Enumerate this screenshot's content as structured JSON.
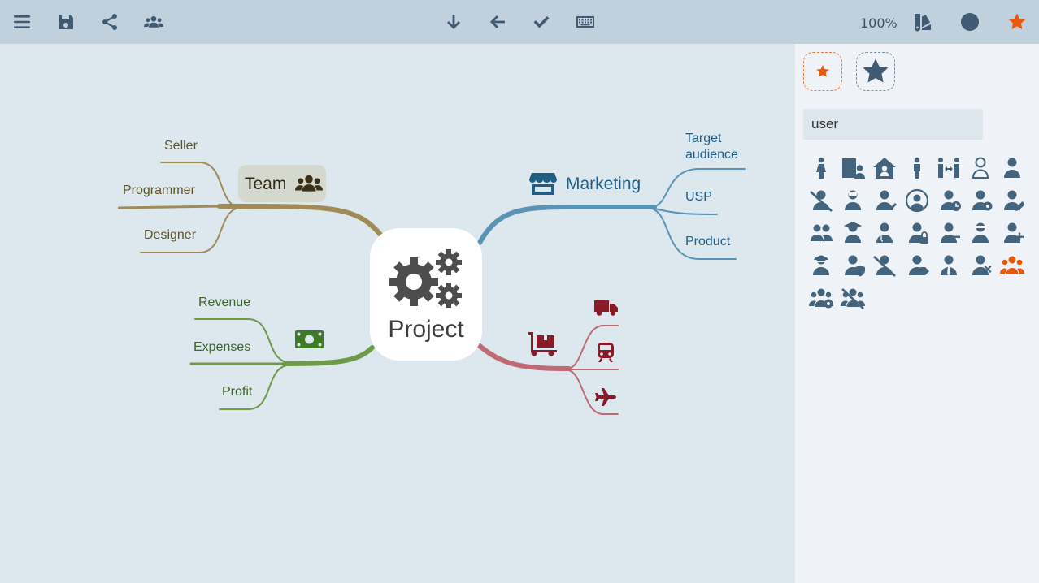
{
  "toolbar": {
    "zoom": "100%",
    "left_buttons": [
      "menu-icon",
      "save-icon",
      "share-icon",
      "users-icon"
    ],
    "center_buttons": [
      "arrow-down-icon",
      "arrow-left-icon",
      "check-icon",
      "keyboard-icon"
    ],
    "right_buttons": [
      "style-swatches-icon",
      "circle-icon",
      "star-icon"
    ]
  },
  "mindmap": {
    "center": {
      "title": "Project",
      "icon": "gears-icon"
    },
    "branches": {
      "team": {
        "label": "Team",
        "icon": "users-icon",
        "color": "#a08b55",
        "children": [
          "Seller",
          "Programmer",
          "Designer"
        ]
      },
      "marketing": {
        "label": "Marketing",
        "icon": "store-icon",
        "color": "#5a93b3",
        "children": [
          "Target",
          "audience",
          "USP",
          "Product"
        ]
      },
      "finance": {
        "icon": "money-icon",
        "color": "#6f9a4a",
        "children": [
          "Revenue",
          "Expenses",
          "Profit"
        ]
      },
      "logistics": {
        "icon": "dolly-icon",
        "color": "#c06a74",
        "children_icons": [
          "truck-icon",
          "train-icon",
          "plane-icon"
        ]
      }
    },
    "text_colors": {
      "team": "#5f5426",
      "marketing": "#1f5f84",
      "finance": "#3e6526"
    }
  },
  "sidebar": {
    "search": {
      "value": "user",
      "placeholder": "Search"
    },
    "style_buttons": [
      "star-small-orange",
      "star-large-dark"
    ],
    "icon_color": "#44647d",
    "selected_color": "#e8590c",
    "icons": [
      "person-dress-icon",
      "building-user-icon",
      "house-user-icon",
      "person-icon",
      "people-arrows-icon",
      "user-outline-icon",
      "user-icon",
      "user-slash-icon",
      "user-astronaut-icon",
      "user-check-icon",
      "circle-user-icon",
      "user-clock-icon",
      "user-gear-icon",
      "user-pen-icon",
      "user-group-icon",
      "user-graduate-icon",
      "user-doctor-icon",
      "user-lock-icon",
      "user-minus-icon",
      "user-ninja-icon",
      "user-plus-icon",
      "user-secret-icon",
      "user-shield-icon",
      "user-slash-outline-icon",
      "user-tag-icon",
      "user-tie-icon",
      "user-xmark-icon",
      "users-icon",
      "users-gear-icon",
      "users-slash-icon"
    ],
    "selected_icon": "users-icon"
  }
}
